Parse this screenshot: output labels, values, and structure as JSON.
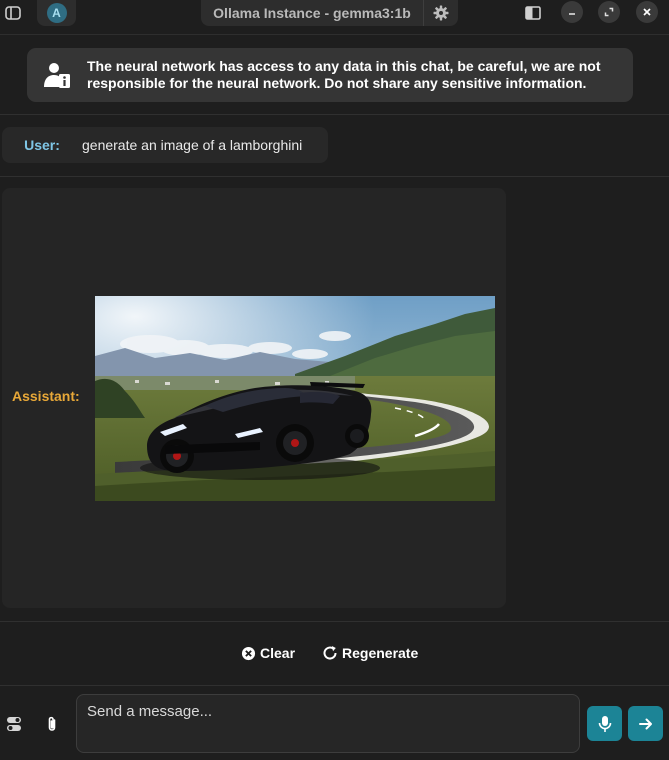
{
  "titlebar": {
    "avatar_letter": "A",
    "title": "Ollama Instance - gemma3:1b",
    "icons": {
      "sidebar_toggle": "sidebar-toggle-icon",
      "settings": "gear-icon",
      "panel": "panel-icon",
      "minimize": "minimize-icon",
      "maximize": "restore-icon",
      "close": "close-icon"
    }
  },
  "banner": {
    "icon": "user-info-icon",
    "text": "The neural network has access to any data in this chat, be careful, we are not responsible for the neural network. Do not share any sensitive information."
  },
  "chat": {
    "user": {
      "label": "User:",
      "text": "generate an image of a lamborghini"
    },
    "assistant": {
      "label": "Assistant:",
      "content": "image"
    }
  },
  "actions": {
    "clear_label": "Clear",
    "regenerate_label": "Regenerate"
  },
  "input": {
    "placeholder": "Send a message...",
    "value": ""
  },
  "colors": {
    "background": "#1e1e1e",
    "user_label": "#7fc6e6",
    "assistant_label": "#e8a838",
    "accent": "#1c8496"
  }
}
